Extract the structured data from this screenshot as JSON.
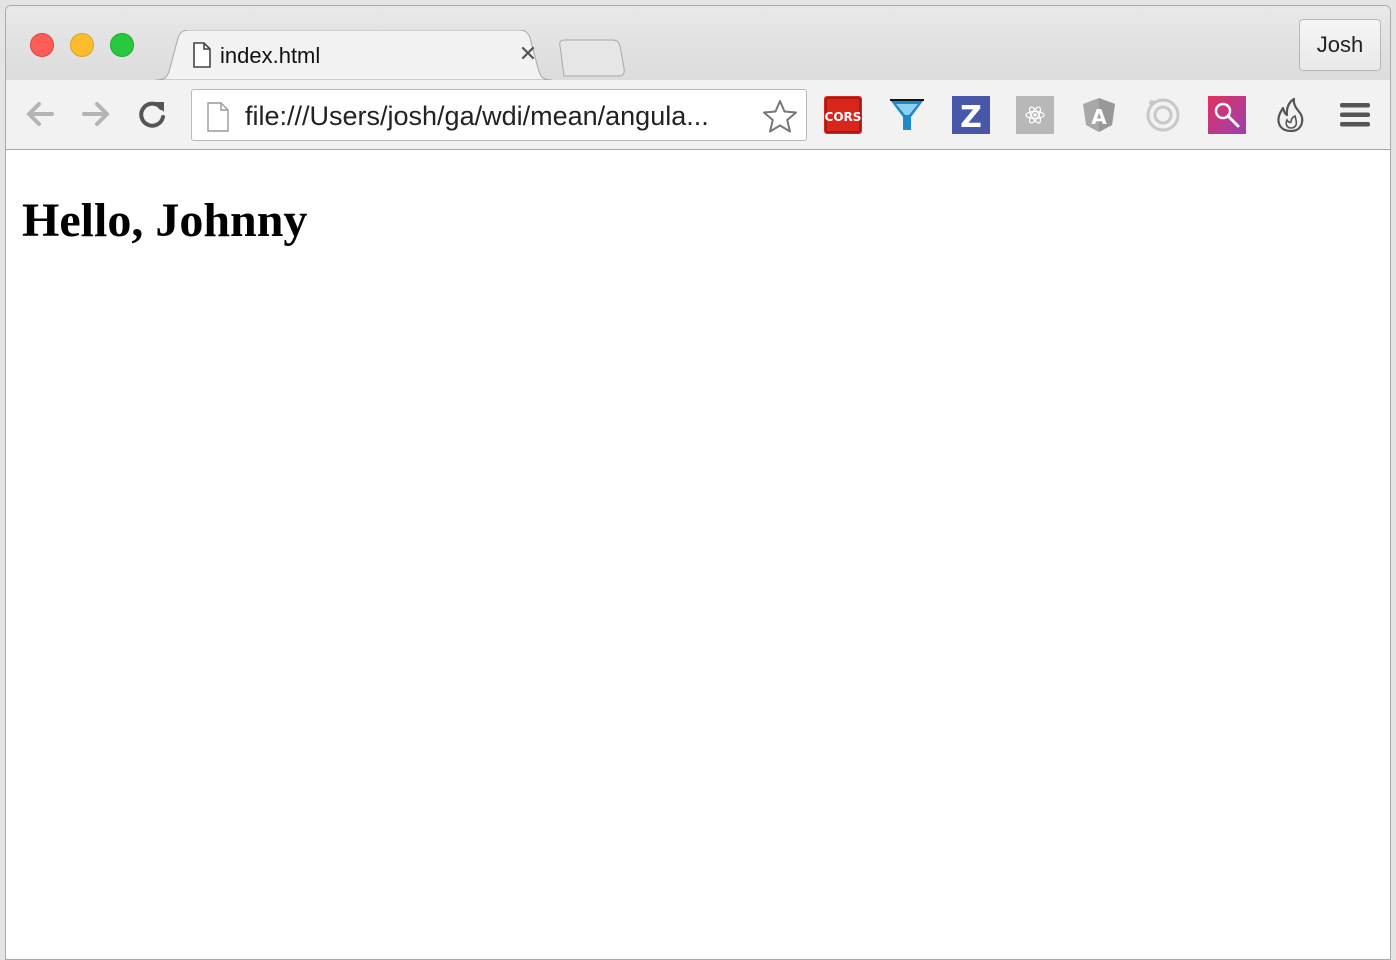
{
  "window": {
    "traffic_lights": [
      "close",
      "minimize",
      "maximize"
    ]
  },
  "tab": {
    "title": "index.html",
    "close_glyph": "✕",
    "icon": "document-icon"
  },
  "profile": {
    "name": "Josh"
  },
  "toolbar": {
    "back_icon": "arrow-left-icon",
    "forward_icon": "arrow-right-icon",
    "reload_icon": "reload-icon",
    "omnibox": {
      "url": "file:///Users/josh/ga/wdi/mean/angula...",
      "page_icon": "document-icon",
      "bookmark_icon": "star-icon"
    },
    "extensions": [
      {
        "name": "cors-extension-icon",
        "label": "CORS",
        "color": "#d9261c"
      },
      {
        "name": "funnel-extension-icon",
        "color": "#1e88c8"
      },
      {
        "name": "z-extension-icon",
        "label": "Z",
        "color": "#4857a8"
      },
      {
        "name": "react-devtools-icon",
        "color": "#b8b8b8"
      },
      {
        "name": "angular-icon",
        "label": "A",
        "color": "#a8a8a8"
      },
      {
        "name": "target-extension-icon",
        "color": "#c8c8c8"
      },
      {
        "name": "search-extension-icon",
        "color": "#d1357c"
      },
      {
        "name": "flame-extension-icon",
        "color": "#555555"
      }
    ],
    "menu_icon": "hamburger-menu-icon"
  },
  "page": {
    "heading": "Hello, Johnny"
  }
}
